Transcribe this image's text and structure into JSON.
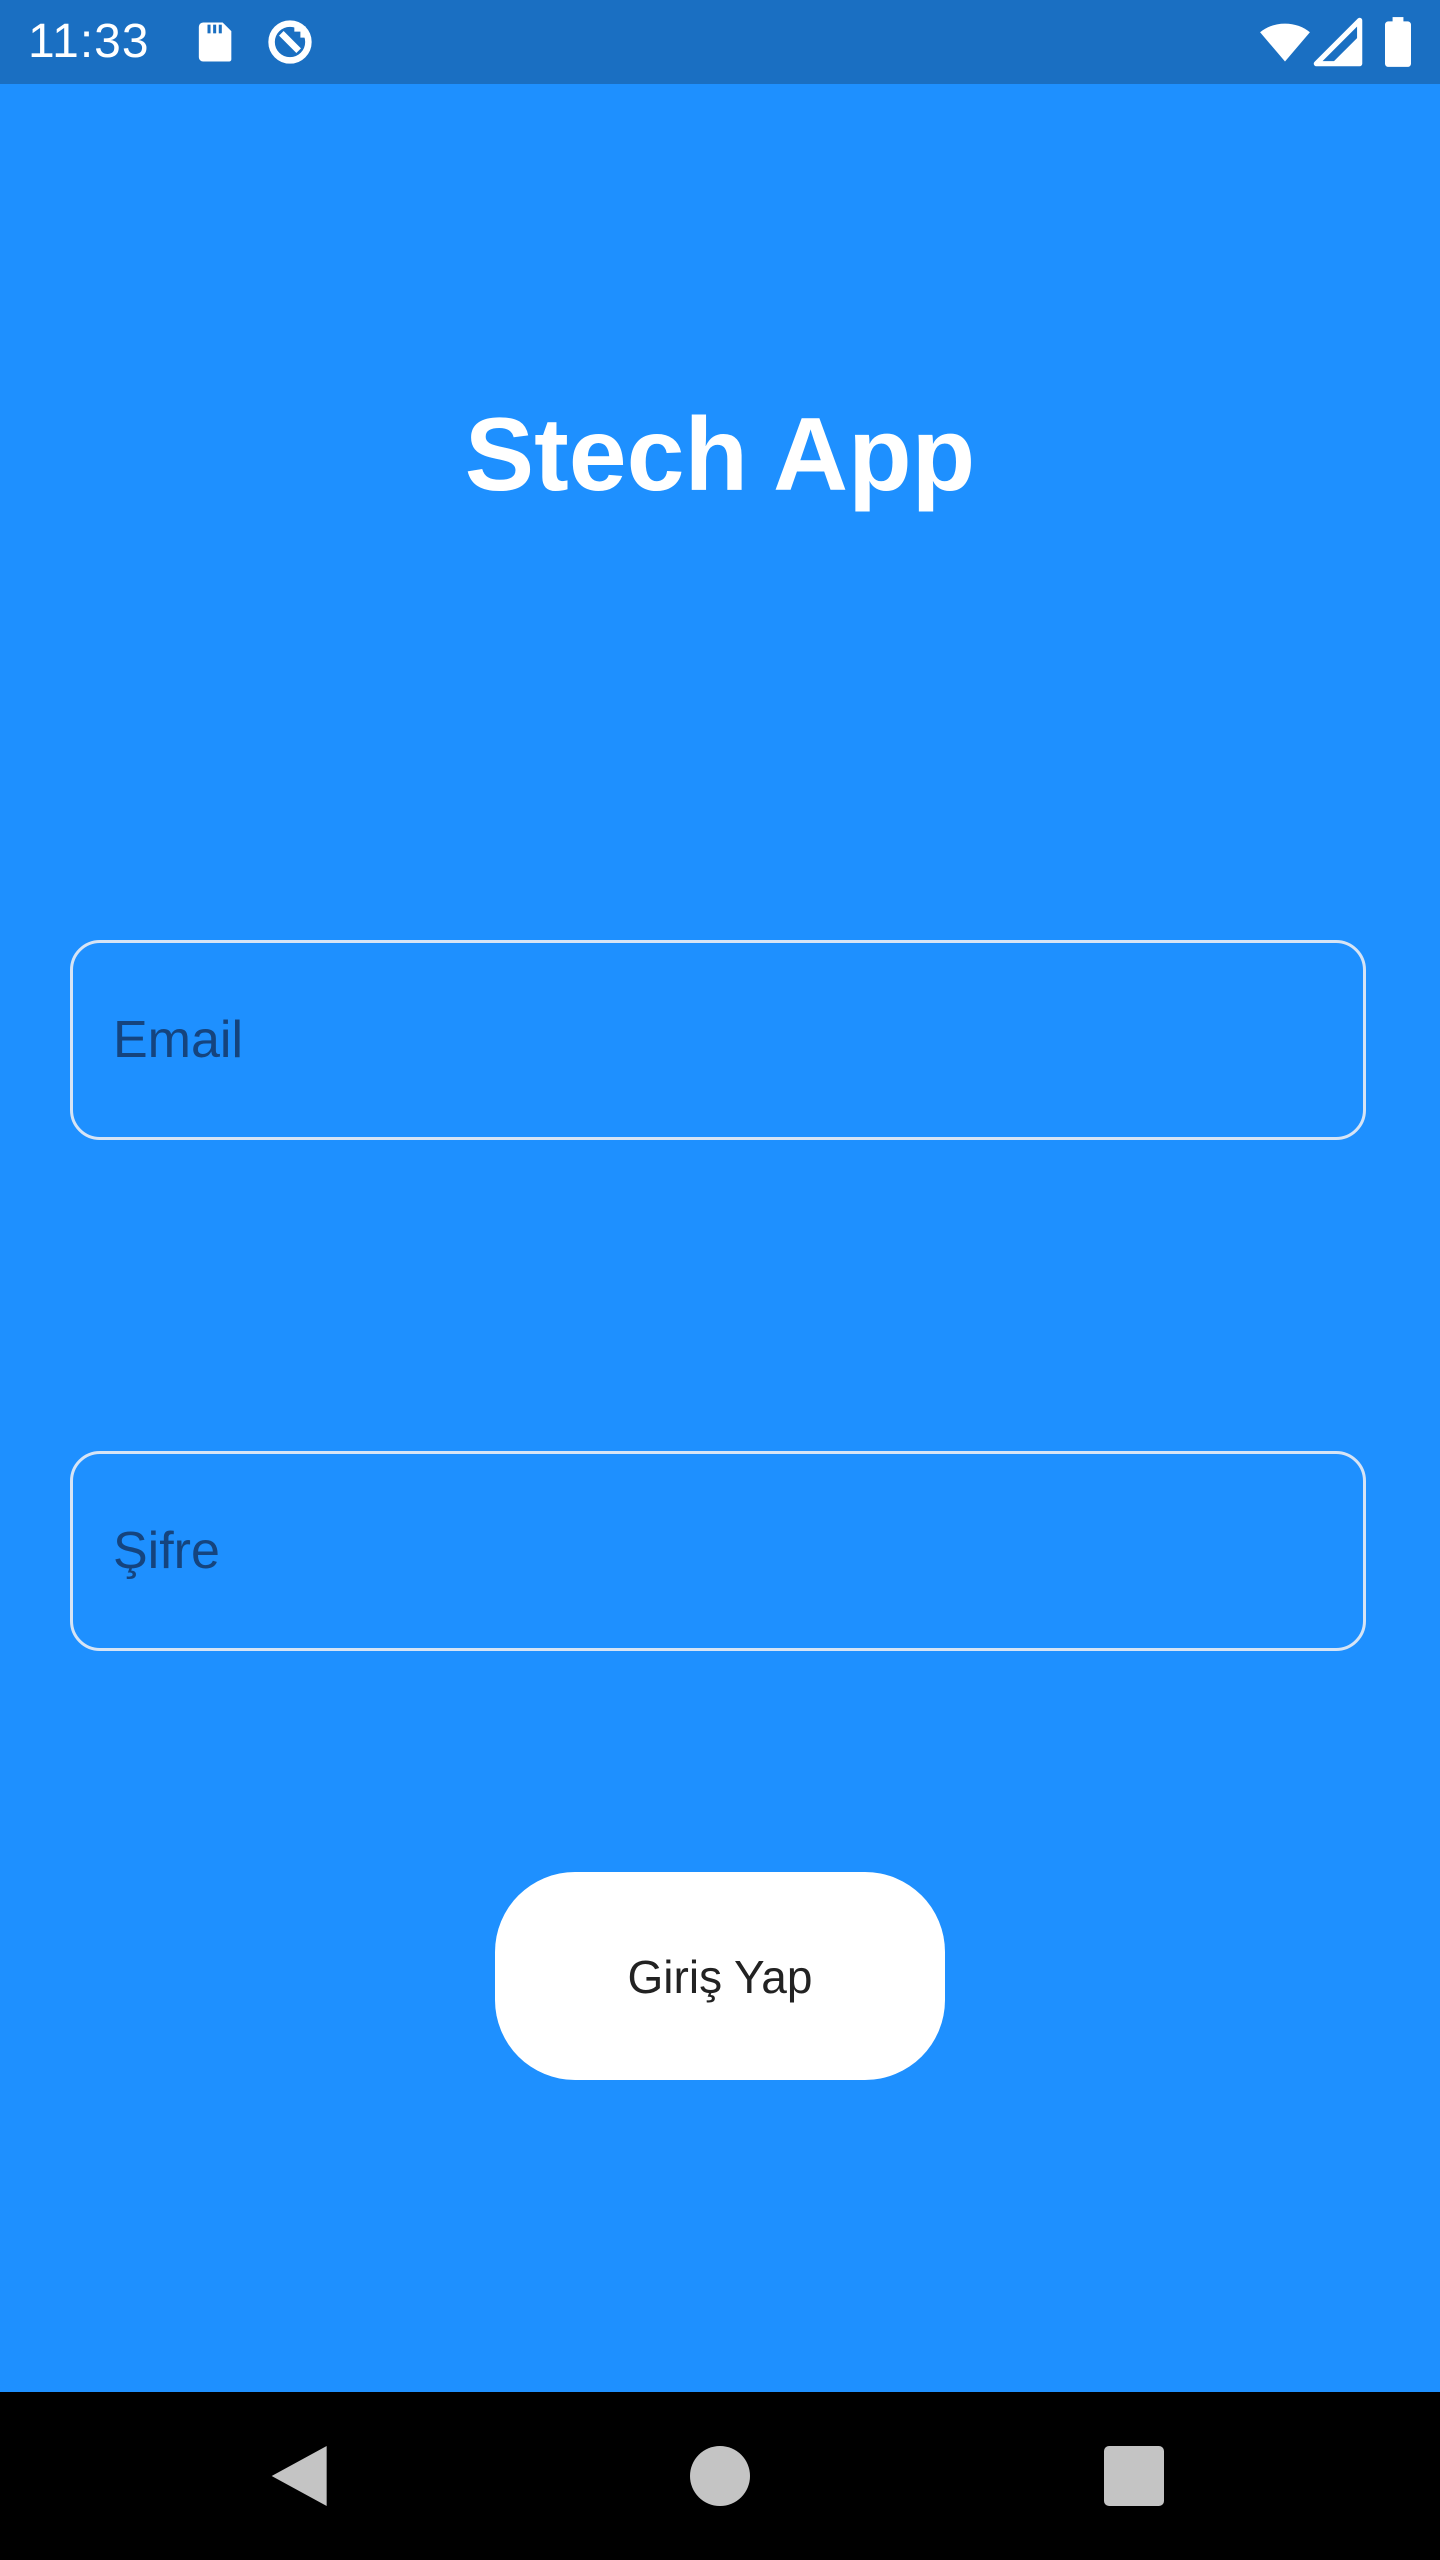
{
  "status_bar": {
    "time": "11:33",
    "left_icons": [
      "sd-card-icon",
      "sync-icon"
    ],
    "right_icons": [
      "wifi-icon",
      "signal-icon",
      "battery-icon"
    ],
    "background": "#1A6FC2"
  },
  "app": {
    "title": "Stech App",
    "background": "#1E90FF"
  },
  "form": {
    "email": {
      "placeholder": "Email",
      "value": ""
    },
    "password": {
      "placeholder": "Şifre",
      "value": ""
    },
    "login_button_label": "Giriş Yap"
  },
  "nav_bar": {
    "buttons": [
      "back-icon",
      "home-icon",
      "recents-icon"
    ]
  }
}
